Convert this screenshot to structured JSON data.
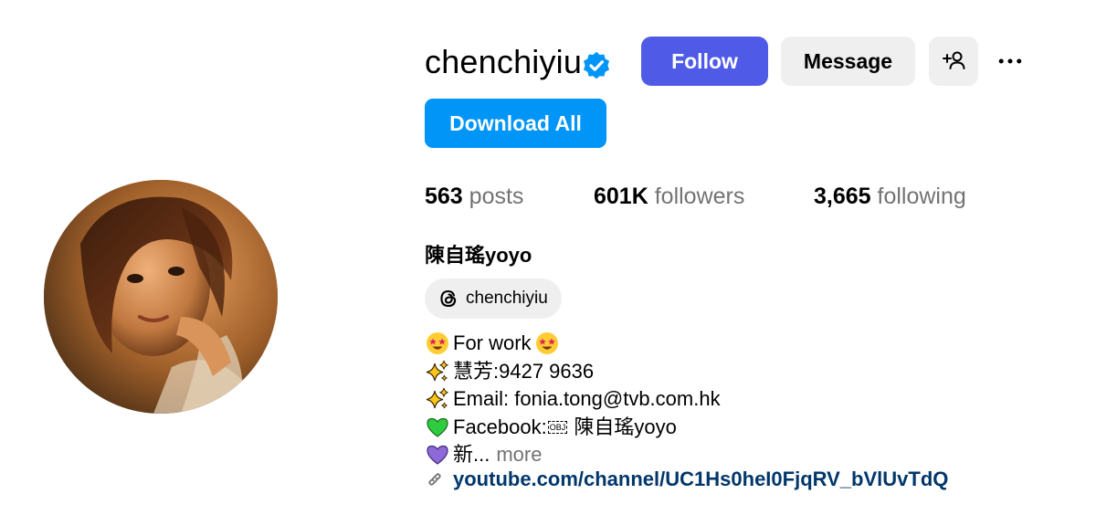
{
  "profile": {
    "username": "chenchiyiu",
    "verified": true,
    "full_name": "陳自瑤yoyo",
    "threads_handle": "chenchiyiu"
  },
  "actions": {
    "follow_label": "Follow",
    "message_label": "Message",
    "download_label": "Download All"
  },
  "stats": {
    "posts_count": "563",
    "posts_label": "posts",
    "followers_count": "601K",
    "followers_label": "followers",
    "following_count": "3,665",
    "following_label": "following"
  },
  "bio": {
    "line1": "For work",
    "line2": "慧芳:9427 9636",
    "line3": "Email: fonia.tong@tvb.com.hk",
    "line4_prefix": "Facebook:",
    "line4_obj": "OBJ",
    "line4_suffix": " 陳自瑤yoyo",
    "line5": "新...",
    "more_label": "more",
    "link": "youtube.com/channel/UC1Hs0heI0FjqRV_bVlUvTdQ"
  },
  "colors": {
    "follow_bg": "#4f5be6",
    "download_bg": "#0095f6",
    "secondary_bg": "#efefef",
    "link_color": "#00376b",
    "muted_text": "#737373",
    "verified_badge": "#0095f6"
  },
  "icons": {
    "verified": "verified-badge-icon",
    "add_user": "add-user-icon",
    "more": "more-options-icon",
    "threads": "threads-icon",
    "link": "link-icon",
    "emoji_star_eyes": "star-struck-emoji-icon",
    "emoji_sparkles": "sparkles-emoji-icon",
    "emoji_green_heart": "green-heart-emoji-icon",
    "emoji_purple_heart": "purple-heart-emoji-icon"
  }
}
